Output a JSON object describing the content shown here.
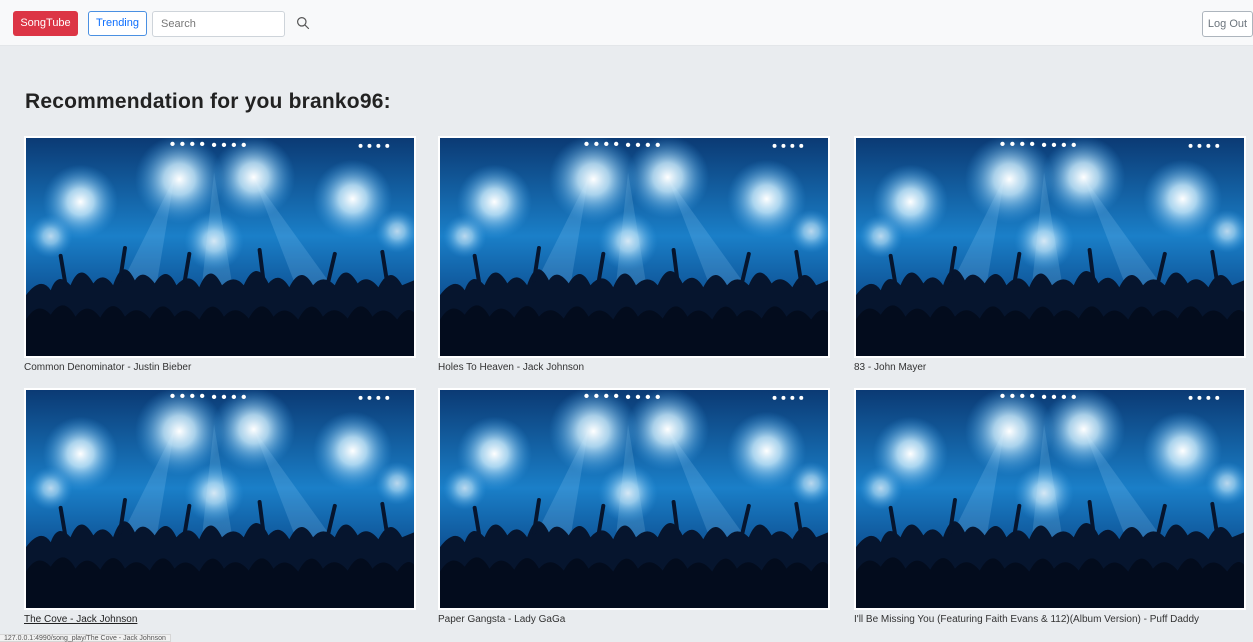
{
  "nav": {
    "brand": "SongTube",
    "trending": "Trending",
    "search_placeholder": "Search",
    "logout": "Log Out",
    "search_icon": "search-icon"
  },
  "heading": "Recommendation for you branko96:",
  "songs": [
    {
      "caption": "Common Denominator - Justin Bieber"
    },
    {
      "caption": "Holes To Heaven - Jack Johnson"
    },
    {
      "caption": "83 - John Mayer"
    },
    {
      "caption": "The Cove - Jack Johnson"
    },
    {
      "caption": "Paper Gangsta - Lady GaGa"
    },
    {
      "caption": "I'll Be Missing You (Featuring Faith Evans & 112)(Album Version) - Puff Daddy"
    }
  ],
  "status_url": "127.0.0.1:4990/song_play/The Cove - Jack Johnson",
  "colors": {
    "brand": "#dc3545",
    "trending_border": "#4a90e2",
    "background": "#e9ecef",
    "navbar": "#f8f9fa"
  }
}
